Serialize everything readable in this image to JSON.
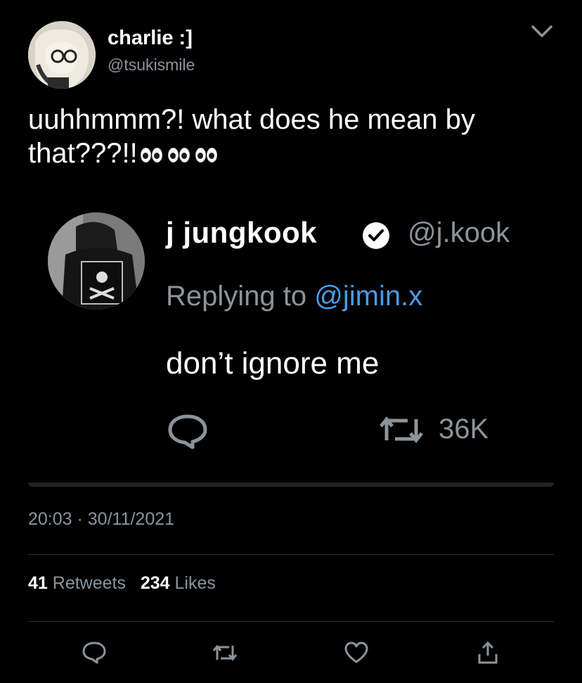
{
  "author": {
    "display_name": "charlie :]",
    "handle": "@tsukismile"
  },
  "tweet": {
    "text": "uuhhmmm?! what does he mean by that???!!",
    "emoji": "eyes-emoji x3",
    "timestamp": "20:03 · 30/11/2021",
    "retweets_count": "41",
    "retweets_label": "Retweets",
    "likes_count": "234",
    "likes_label": "Likes"
  },
  "embedded_tweet": {
    "display_name": "j jungkook",
    "handle": "@j.kook",
    "replying_prefix": "Replying to",
    "replying_mention": "@jimin.x",
    "text": "don’t ignore me",
    "retweet_count": "36K"
  },
  "colors": {
    "background": "#000000",
    "secondary_text": "#8b949b",
    "accent_blue": "#4a9be8",
    "divider": "#2f3336"
  },
  "icons": [
    "chevron-down-icon",
    "verified-badge-icon",
    "reply-icon",
    "retweet-icon",
    "like-icon",
    "share-icon"
  ]
}
